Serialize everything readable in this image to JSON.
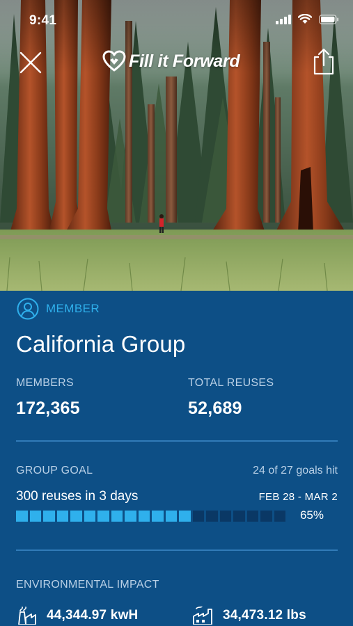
{
  "status_bar": {
    "time": "9:41"
  },
  "brand": {
    "name": "Fill it Forward"
  },
  "membership": {
    "badge": "MEMBER"
  },
  "group": {
    "name": "California Group"
  },
  "stats": {
    "members_label": "MEMBERS",
    "members_value": "172,365",
    "reuses_label": "TOTAL REUSES",
    "reuses_value": "52,689"
  },
  "goal": {
    "label": "GROUP GOAL",
    "hits": "24 of 27 goals hit",
    "title": "300 reuses in 3 days",
    "dates": "FEB 28 - MAR 2",
    "progress_fraction": 0.65,
    "progress_label": "65%"
  },
  "impact": {
    "label": "ENVIRONMENTAL IMPACT",
    "energy": "44,344.97 kwH",
    "emissions": "34,473.12 lbs"
  },
  "icons": {
    "close": "close-icon",
    "share": "share-icon",
    "brand": "heart-logo-icon",
    "member": "user-circle-icon",
    "energy": "power-plant-icon",
    "emissions": "factory-icon"
  },
  "colors": {
    "panel": "#0d4f86",
    "accent": "#2fb0ec",
    "progress_empty": "#0a3865"
  }
}
